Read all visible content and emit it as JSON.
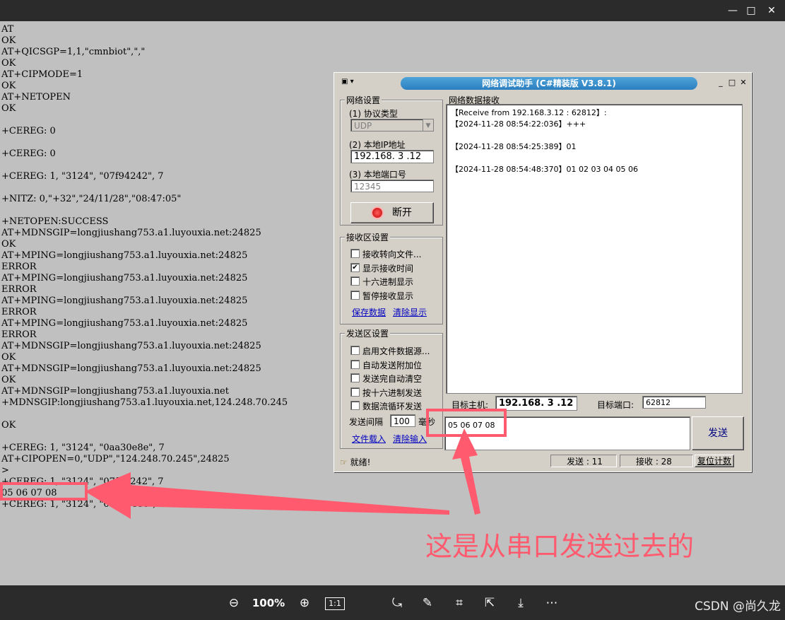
{
  "viewer": {
    "window_controls": [
      "—",
      "□",
      "✕"
    ],
    "zoom": "100%",
    "actual_size": "1:1",
    "watermark": "CSDN @尚久龙"
  },
  "log_lines": [
    "AT",
    "OK",
    "AT+QICSGP=1,1,\"cmnbiot\",\",\"",
    "OK",
    "AT+CIPMODE=1",
    "OK",
    "AT+NETOPEN",
    "OK",
    "",
    "+CEREG: 0",
    "",
    "+CEREG: 0",
    "",
    "+CEREG: 1, \"3124\", \"07f94242\", 7",
    "",
    "+NITZ: 0,\"+32\",\"24/11/28\",\"08:47:05\"",
    "",
    "+NETOPEN:SUCCESS",
    "AT+MDNSGIP=longjiushang753.a1.luyouxia.net:24825",
    "OK",
    "AT+MPING=longjiushang753.a1.luyouxia.net:24825",
    "ERROR",
    "AT+MPING=longjiushang753.a1.luyouxia.net:24825",
    "ERROR",
    "AT+MPING=longjiushang753.a1.luyouxia.net:24825",
    "ERROR",
    "AT+MPING=longjiushang753.a1.luyouxia.net:24825",
    "ERROR",
    "AT+MDNSGIP=longjiushang753.a1.luyouxia.net:24825",
    "OK",
    "AT+MDNSGIP=longjiushang753.a1.luyouxia.net:24825",
    "OK",
    "AT+MDNSGIP=longjiushang753.a1.luyouxia.net",
    "+MDNSGIP:longjiushang753.a1.luyouxia.net,124.248.70.245",
    "",
    "OK",
    "",
    "+CEREG: 1, \"3124\", \"0aa30e8e\", 7",
    "AT+CIPOPEN=0,\"UDP\",\"124.248.70.245\",24825",
    ">",
    "+CEREG: 1, \"3124\", \"07f94242\", 7",
    "05 06 07 08",
    "+CEREG: 1, \"3124\", \"0aa30e8e\", 7"
  ],
  "netassist": {
    "title": "网络调试助手 (C#精装版 V3.8.1)",
    "net_settings": {
      "group_title": "网络设置",
      "protocol_label": "(1) 协议类型",
      "protocol_value": "UDP",
      "ip_label": "(2) 本地IP地址",
      "ip_value": "192.168. 3 .12",
      "port_label": "(3) 本地端口号",
      "port_value": "12345",
      "disconnect_label": "断开"
    },
    "recv_settings": {
      "group_title": "接收区设置",
      "options": [
        {
          "label": "接收转向文件...",
          "checked": false
        },
        {
          "label": "显示接收时间",
          "checked": true
        },
        {
          "label": "十六进制显示",
          "checked": false
        },
        {
          "label": "暂停接收显示",
          "checked": false
        }
      ],
      "save_link": "保存数据",
      "clear_link": "清除显示"
    },
    "send_settings": {
      "group_title": "发送区设置",
      "options": [
        {
          "label": "启用文件数据源...",
          "checked": false
        },
        {
          "label": "自动发送附加位",
          "checked": false
        },
        {
          "label": "发送完自动清空",
          "checked": false
        },
        {
          "label": "按十六进制发送",
          "checked": false
        },
        {
          "label": "数据流循环发送",
          "checked": false
        }
      ],
      "interval_label": "发送间隔",
      "interval_value": "100",
      "interval_unit": "毫秒",
      "load_link": "文件载入",
      "clear_link": "清除输入"
    },
    "recv_area": {
      "group_title": "网络数据接收",
      "lines": [
        "【Receive from 192.168.3.12 : 62812】:",
        "【2024-11-28 08:54:22:036】+++",
        "",
        "【2024-11-28 08:54:25:389】01",
        "",
        "【2024-11-28 08:54:48:370】01 02 03 04 05 06"
      ]
    },
    "target": {
      "host_label": "目标主机:",
      "host_value": "192.168. 3 .12",
      "port_label": "目标端口:",
      "port_value": "62812"
    },
    "send_input": "05 06 07 08",
    "send_button": "发送",
    "status": {
      "ready": "就绪!",
      "sent": "发送 : 11",
      "received": "接收 : 28",
      "reset": "复位计数"
    }
  },
  "annotation": {
    "caption": "这是从串口发送过去的",
    "color": "#ff5a6e"
  }
}
